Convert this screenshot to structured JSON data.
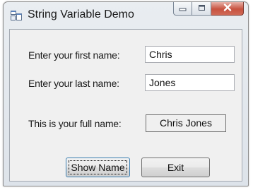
{
  "window": {
    "title": "String Variable Demo"
  },
  "form": {
    "first_name_label": "Enter your first name:",
    "first_name_value": "Chris",
    "last_name_label": "Enter your last name:",
    "last_name_value": "Jones",
    "full_name_label": "This is your full name:",
    "full_name_value": "Chris Jones"
  },
  "buttons": {
    "show_name": "Show Name",
    "exit": "Exit"
  },
  "icons": {
    "app": "form-icon",
    "minimize": "minimize-icon",
    "maximize": "maximize-icon",
    "close": "close-icon"
  }
}
